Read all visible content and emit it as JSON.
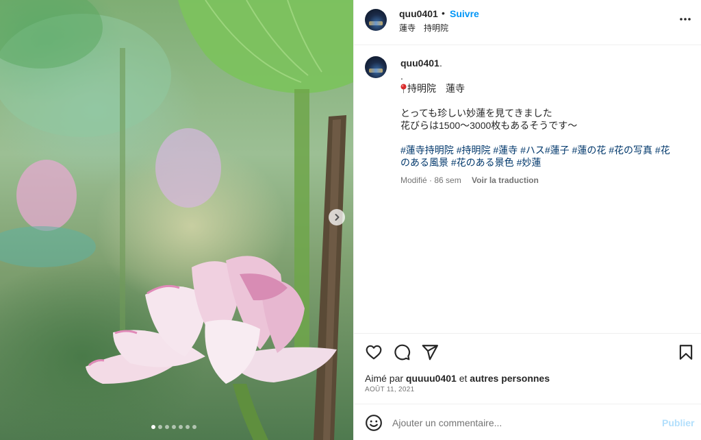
{
  "header": {
    "username": "quu0401",
    "separator": "•",
    "follow_label": "Suivre",
    "location": "蓮寺　持明院",
    "more_icon": "more-horizontal-icon"
  },
  "caption": {
    "username": "quu0401",
    "trailing_dot": ".",
    "line_dot": ".",
    "place_line": "持明院　蓮寺",
    "text_line1": "とっても珍しい妙蓮を見てきました",
    "text_line2": "花びらは1500〜3000枚もあるそうです〜",
    "tags_line1": [
      "#蓮寺持明院",
      "#持明院",
      "#蓮寺",
      "#ハス#蓮子",
      "#蓮の花",
      "#花の写真",
      "#花"
    ],
    "tags_line2": [
      "のある風景",
      "#花のある景色",
      "#妙蓮"
    ],
    "modified": "Modifié · 86 sem",
    "translate_label": "Voir la traduction"
  },
  "actions": {
    "like_icon": "heart-icon",
    "comment_icon": "comment-icon",
    "share_icon": "send-icon",
    "save_icon": "bookmark-icon"
  },
  "likes": {
    "prefix": "Aimé par",
    "user": "quuuu0401",
    "conj": "et",
    "others": "autres personnes"
  },
  "date": "AOÛT 11, 2021",
  "comment": {
    "placeholder": "Ajouter un commentaire...",
    "publish_label": "Publier"
  },
  "carousel": {
    "count": 7,
    "active_index": 0,
    "next_icon": "chevron-right-icon"
  },
  "colors": {
    "link_blue": "#0095f6",
    "hashtag_blue": "#00376b",
    "publish_disabled": "#b2dffc",
    "muted": "#737373"
  }
}
